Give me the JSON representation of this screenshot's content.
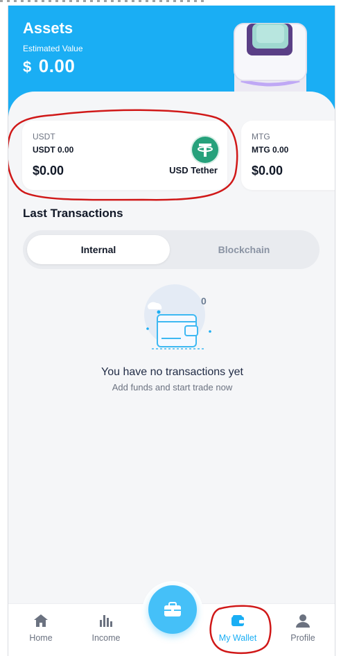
{
  "header": {
    "title": "Assets",
    "subtitle": "Estimated Value",
    "currency_symbol": "$",
    "amount": "0.00"
  },
  "assets": [
    {
      "symbol": "USDT",
      "balance": "USDT 0.00",
      "usd_value": "$0.00",
      "name": "USD Tether"
    },
    {
      "symbol": "MTG",
      "balance": "MTG 0.00",
      "usd_value": "$0.00"
    }
  ],
  "transactions": {
    "title": "Last Transactions",
    "tabs": [
      {
        "label": "Internal",
        "active": true
      },
      {
        "label": "Blockchain",
        "active": false
      }
    ],
    "count": "0",
    "empty_title": "You have no transactions yet",
    "empty_subtitle": "Add funds and start trade now"
  },
  "nav": {
    "items": [
      {
        "label": "Home",
        "icon": "home-icon"
      },
      {
        "label": "Income",
        "icon": "bar-chart-icon"
      },
      {
        "label": "My Wallet",
        "icon": "wallet-icon",
        "active": true
      },
      {
        "label": "Profile",
        "icon": "user-icon"
      }
    ],
    "fab_icon": "briefcase-icon"
  },
  "colors": {
    "accent": "#1aaef4",
    "fab": "#45c0f8",
    "tether": "#26a17b",
    "background": "#f5f6f8",
    "annotation": "#d01818"
  }
}
